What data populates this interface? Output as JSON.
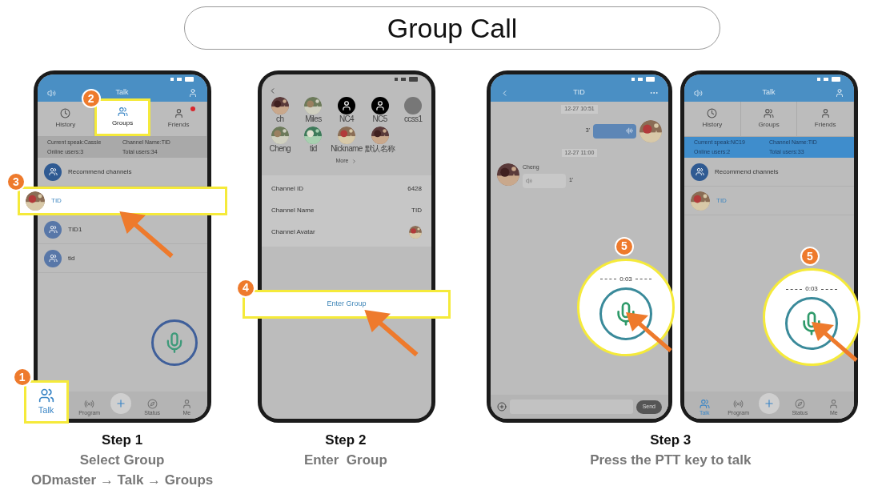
{
  "title": "Group Call",
  "phones": [
    {
      "kind": "talk",
      "header": {
        "title": "Talk"
      },
      "tabs": [
        {
          "kind": "history",
          "label": "History",
          "selected": false,
          "notification": false
        },
        {
          "kind": "groups",
          "label": "Groups",
          "selected": true,
          "notification": false,
          "callout": "2"
        },
        {
          "kind": "friends",
          "label": "Friends",
          "selected": false,
          "notification": true
        }
      ],
      "info_bar": {
        "active": false,
        "items": [
          "Current speak:Cassie",
          "Channel Name:TID",
          "Online users:3",
          "Total users:34"
        ]
      },
      "channels": [
        {
          "kind": "recommend",
          "name": "Recommend channels"
        },
        {
          "name": "TID",
          "callout": "3"
        },
        {
          "kind": "group",
          "name": "TID1"
        },
        {
          "kind": "group",
          "name": "tid"
        }
      ],
      "mic": {
        "recording": false
      },
      "nav": [
        {
          "kind": "talk",
          "label": "Talk",
          "selected": true,
          "callout": "1"
        },
        {
          "kind": "program",
          "label": "Program",
          "selected": false
        },
        {
          "kind": "add",
          "selected": false
        },
        {
          "kind": "status",
          "label": "Status",
          "selected": false
        },
        {
          "kind": "me",
          "label": "Me",
          "selected": false
        }
      ]
    },
    {
      "kind": "info",
      "members": [
        {
          "name": "ch"
        },
        {
          "name": "Miles"
        },
        {
          "kind": "default",
          "name": "NC4"
        },
        {
          "kind": "default",
          "name": "NC5"
        },
        {
          "kind": "blank",
          "name": "ccss1"
        },
        {
          "name": "Cheng"
        },
        {
          "name": "tid"
        },
        {
          "name": "Nickname"
        },
        {
          "name": "默认名称"
        }
      ],
      "more": "More",
      "fields": [
        {
          "kind": "text",
          "label": "Channel ID",
          "value": "6428"
        },
        {
          "kind": "text",
          "label": "Channel Name",
          "value": "TID"
        },
        {
          "kind": "avatar",
          "label": "Channel Avatar"
        }
      ],
      "action": {
        "label": "Enter Group",
        "callout": "4"
      }
    },
    {
      "kind": "chat",
      "header": {
        "title": "TID"
      },
      "messages": [
        {
          "kind": "time",
          "text": "12-27 10:51"
        },
        {
          "kind": "voice",
          "outgoing": true,
          "duration": "3'"
        },
        {
          "kind": "time",
          "text": "12-27 11:00"
        },
        {
          "kind": "voice",
          "outgoing": false,
          "sender": "Cheng",
          "duration": "1'"
        }
      ],
      "mic": {
        "recording": true,
        "timer": "0:03",
        "callout": "5"
      },
      "send": "Send"
    },
    {
      "kind": "talk",
      "header": {
        "title": "Talk"
      },
      "tabs": [
        {
          "kind": "history",
          "label": "History",
          "selected": false,
          "notification": false
        },
        {
          "kind": "groups",
          "label": "Groups",
          "selected": false,
          "notification": false
        },
        {
          "kind": "friends",
          "label": "Friends",
          "selected": false,
          "notification": false
        }
      ],
      "info_bar": {
        "active": true,
        "items": [
          "Current speak:NC19",
          "Channel Name:TID",
          "Online users:2",
          "Total users:33"
        ]
      },
      "channels": [
        {
          "kind": "recommend",
          "name": "Recommend channels"
        },
        {
          "name": "TID"
        }
      ],
      "mic": {
        "recording": true,
        "timer": "0:03",
        "callout": "5"
      },
      "nav": [
        {
          "kind": "talk",
          "label": "Talk",
          "selected": true
        },
        {
          "kind": "program",
          "label": "Program",
          "selected": false
        },
        {
          "kind": "add",
          "selected": false
        },
        {
          "kind": "status",
          "label": "Status",
          "selected": false
        },
        {
          "kind": "me",
          "label": "Me",
          "selected": false
        }
      ]
    }
  ],
  "steps": [
    {
      "heading": "Step 1",
      "lines": [
        "Select Group",
        "ODmaster → Talk → Groups"
      ]
    },
    {
      "heading": "Step 2",
      "lines": [
        "Enter  Group"
      ]
    },
    {
      "heading": "Step 3",
      "lines": [
        "Press the PTT key to talk"
      ]
    }
  ]
}
